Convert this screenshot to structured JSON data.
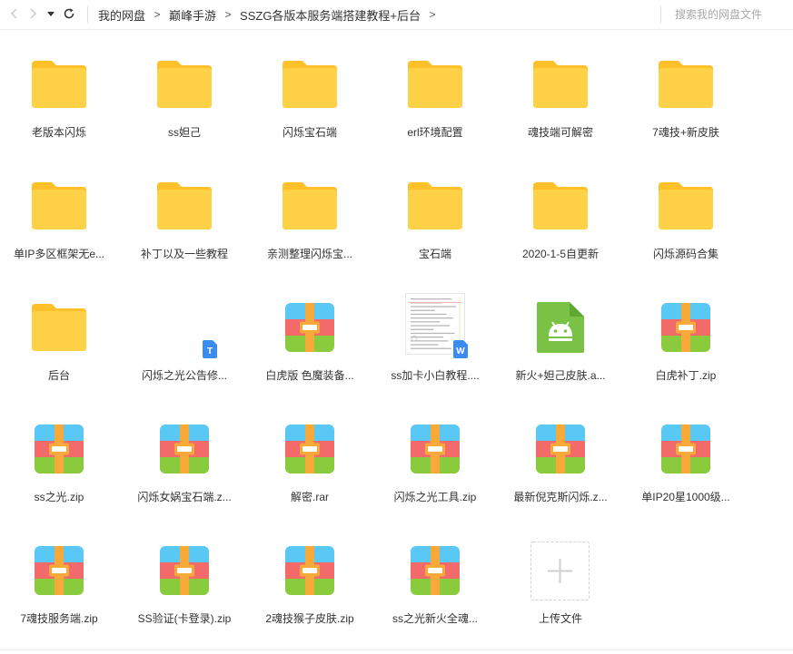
{
  "toolbar": {
    "breadcrumb": [
      "我的网盘",
      "巅峰手游",
      "SSZG各版本服务端搭建教程+后台"
    ],
    "search_placeholder": "搜索我的网盘文件"
  },
  "files": [
    {
      "name": "老版本闪烁",
      "type": "folder"
    },
    {
      "name": "ss妲己",
      "type": "folder"
    },
    {
      "name": "闪烁宝石端",
      "type": "folder"
    },
    {
      "name": "erl环境配置",
      "type": "folder"
    },
    {
      "name": "魂技端可解密",
      "type": "folder"
    },
    {
      "name": "7魂技+新皮肤",
      "type": "folder"
    },
    {
      "name": "单IP多区框架无e...",
      "type": "folder"
    },
    {
      "name": "补丁以及一些教程",
      "type": "folder"
    },
    {
      "name": "亲测整理闪烁宝...",
      "type": "folder"
    },
    {
      "name": "宝石端",
      "type": "folder"
    },
    {
      "name": "2020-1-5自更新",
      "type": "folder"
    },
    {
      "name": "闪烁源码合集",
      "type": "folder"
    },
    {
      "name": "后台",
      "type": "folder"
    },
    {
      "name": "闪烁之光公告修...",
      "type": "txt",
      "badge": "T"
    },
    {
      "name": "白虎版 色魔装备...",
      "type": "zip"
    },
    {
      "name": "ss加卡小白教程....",
      "type": "doc",
      "badge": "W"
    },
    {
      "name": "新火+妲己皮肤.a...",
      "type": "apk"
    },
    {
      "name": "白虎补丁.zip",
      "type": "zip"
    },
    {
      "name": "ss之光.zip",
      "type": "zip"
    },
    {
      "name": "闪烁女娲宝石端.z...",
      "type": "zip"
    },
    {
      "name": "解密.rar",
      "type": "zip"
    },
    {
      "name": "闪烁之光工具.zip",
      "type": "zip"
    },
    {
      "name": "最新倪克斯闪烁.z...",
      "type": "zip"
    },
    {
      "name": "单IP20星1000级...",
      "type": "zip"
    },
    {
      "name": "7魂技服务端.zip",
      "type": "zip"
    },
    {
      "name": "SS验证(卡登录).zip",
      "type": "zip"
    },
    {
      "name": "2魂技猴子皮肤.zip",
      "type": "zip"
    },
    {
      "name": "ss之光新火全魂...",
      "type": "zip"
    },
    {
      "name": "上传文件",
      "type": "upload"
    }
  ],
  "colors": {
    "folder": "#ffd147",
    "folder_tab": "#ffc02a",
    "zip_blue": "#5ac8f5",
    "zip_red": "#f26a6a",
    "zip_green": "#8acb3e",
    "zip_strap": "#f7a93a",
    "apk_green": "#79c245",
    "badge_blue": "#3b8cf0"
  }
}
